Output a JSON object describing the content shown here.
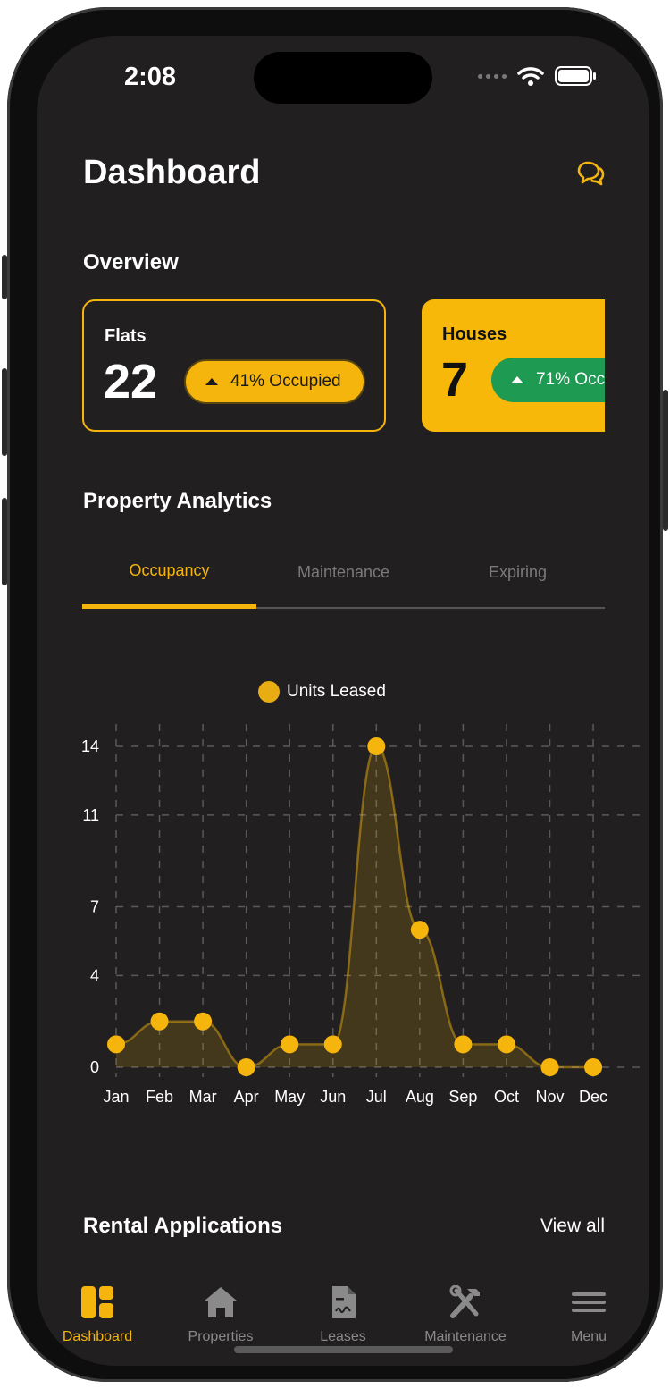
{
  "status_bar": {
    "time": "2:08"
  },
  "header": {
    "title": "Dashboard",
    "chat_icon": "chat-bubbles-icon"
  },
  "overview": {
    "heading": "Overview",
    "cards": [
      {
        "label": "Flats",
        "count": "22",
        "badge": "41% Occupied",
        "badge_color": "#f5b50d"
      },
      {
        "label": "Houses",
        "count": "7",
        "badge": "71% Occu",
        "badge_color": "#1e9a53",
        "card_color": "#f7b80a"
      }
    ]
  },
  "analytics": {
    "heading": "Property Analytics",
    "tabs": [
      {
        "label": "Occupancy",
        "active": true
      },
      {
        "label": "Maintenance",
        "active": false
      },
      {
        "label": "Expiring",
        "active": false
      }
    ]
  },
  "chart_data": {
    "type": "area",
    "legend": "Units Leased",
    "categories": [
      "Jan",
      "Feb",
      "Mar",
      "Apr",
      "May",
      "Jun",
      "Jul",
      "Aug",
      "Sep",
      "Oct",
      "Nov",
      "Dec"
    ],
    "values": [
      1,
      2,
      2,
      0,
      1,
      1,
      14,
      6,
      1,
      1,
      0,
      0
    ],
    "y_ticks": [
      "0",
      "4",
      "7",
      "11",
      "14"
    ],
    "ylim": [
      0,
      14
    ],
    "grid": true,
    "color": "#f5b50d"
  },
  "rental": {
    "heading": "Rental Applications",
    "view_all": "View all"
  },
  "tab_bar": {
    "items": [
      {
        "label": "Dashboard",
        "icon": "dashboard-icon",
        "active": true
      },
      {
        "label": "Properties",
        "icon": "home-icon",
        "active": false
      },
      {
        "label": "Leases",
        "icon": "document-icon",
        "active": false
      },
      {
        "label": "Maintenance",
        "icon": "tools-icon",
        "active": false
      },
      {
        "label": "Menu",
        "icon": "menu-icon",
        "active": false
      }
    ]
  }
}
